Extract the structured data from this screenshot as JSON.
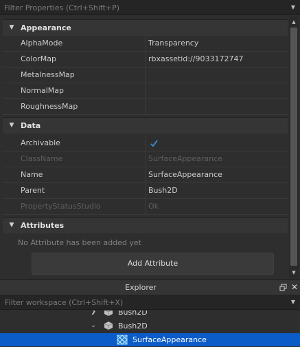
{
  "properties": {
    "filter_placeholder": "Filter Properties (Ctrl+Shift+P)",
    "sections": {
      "appearance": {
        "title": "Appearance",
        "rows": [
          {
            "name": "AlphaMode",
            "value": "Transparency"
          },
          {
            "name": "ColorMap",
            "value": "rbxassetid://9033172747"
          },
          {
            "name": "MetalnessMap",
            "value": ""
          },
          {
            "name": "NormalMap",
            "value": ""
          },
          {
            "name": "RoughnessMap",
            "value": ""
          }
        ]
      },
      "data": {
        "title": "Data",
        "rows": [
          {
            "name": "Archivable",
            "value": "true"
          },
          {
            "name": "ClassName",
            "value": "SurfaceAppearance"
          },
          {
            "name": "Name",
            "value": "SurfaceAppearance"
          },
          {
            "name": "Parent",
            "value": "Bush2D"
          },
          {
            "name": "PropertyStatusStudio",
            "value": "Ok"
          }
        ]
      },
      "attributes": {
        "title": "Attributes",
        "empty_text": "No Attribute has been added yet",
        "add_button": "Add Attribute"
      }
    }
  },
  "explorer": {
    "title": "Explorer",
    "filter_placeholder": "Filter workspace (Ctrl+Shift+X)",
    "tree": [
      {
        "label": "Bush2D",
        "expanded": false
      },
      {
        "label": "Bush2D",
        "expanded": true
      },
      {
        "label": "SurfaceAppearance",
        "selected": true
      }
    ]
  },
  "colors": {
    "accent_check": "#3d8fe0",
    "selection": "#0b5cc8"
  }
}
